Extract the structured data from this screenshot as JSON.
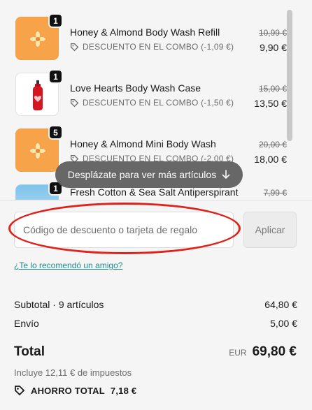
{
  "cart": {
    "items": [
      {
        "quantity": "1",
        "title": "Honey & Almond Body Wash Refill",
        "discount": "DESCUENTO EN EL COMBO (-1,09 €)",
        "original_price": "10,99 €",
        "price": "9,90 €",
        "thumb_icon": "honey-flower-icon"
      },
      {
        "quantity": "1",
        "title": "Love Hearts Body Wash Case",
        "discount": "DESCUENTO EN EL COMBO (-1,50 €)",
        "original_price": "15,00 €",
        "price": "13,50 €",
        "thumb_icon": "red-bottle-icon"
      },
      {
        "quantity": "5",
        "title": "Honey & Almond Mini Body Wash",
        "discount": "DESCUENTO EN EL COMBO (-2,00 €)",
        "original_price": "20,00 €",
        "price": "18,00 €",
        "thumb_icon": "honey-flower-icon"
      },
      {
        "quantity": "1",
        "title": "Fresh Cotton & Sea Salt Antiperspirant",
        "discount": "",
        "original_price": "7,99 €",
        "price": "",
        "thumb_icon": "blue-sky-icon"
      }
    ],
    "scroll_hint": "Desplázate para ver más artículos",
    "scroll_hint_icon": "arrow-down-icon"
  },
  "discount": {
    "placeholder": "Código de descuento o tarjeta de regalo",
    "apply_label": "Aplicar",
    "referral_link": "¿Te lo recomendó un amigo?"
  },
  "summary": {
    "subtotal_label": "Subtotal · 9 artículos",
    "subtotal_value": "64,80 €",
    "shipping_label": "Envío",
    "shipping_value": "5,00 €",
    "total_label": "Total",
    "currency": "EUR",
    "total_value": "69,80 €",
    "taxes": "Incluye 12,11 € de impuestos",
    "savings_label": "AHORRO TOTAL",
    "savings_value": "7,18 €"
  },
  "colors": {
    "accent_link": "#1f8a8a",
    "annotation_red": "#e0221b",
    "honey_orange": "#f6a34a"
  }
}
